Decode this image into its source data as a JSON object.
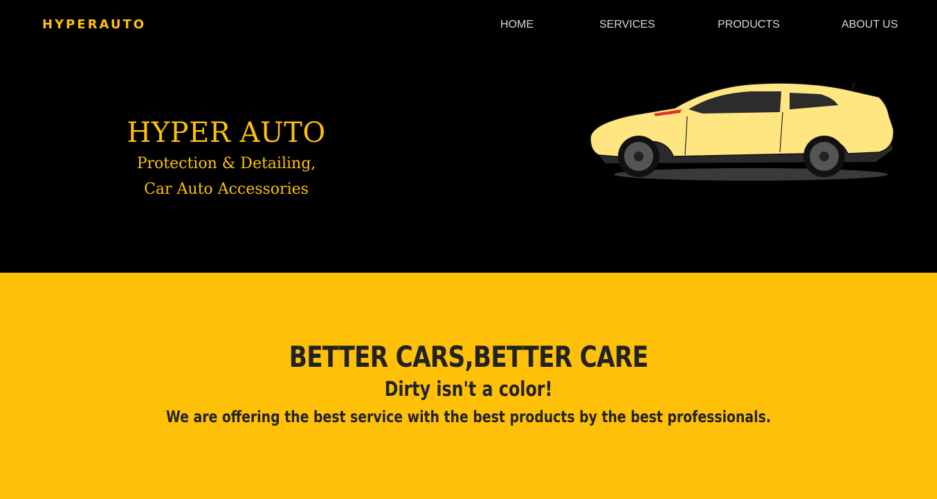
{
  "brand": {
    "logo_text": "HYPERAUTO",
    "color": "#ffc107"
  },
  "nav": {
    "items": [
      {
        "label": "HOME"
      },
      {
        "label": "SERVICES"
      },
      {
        "label": "PRODUCTS"
      },
      {
        "label": "ABOUT US"
      }
    ]
  },
  "hero": {
    "title": "HYPER AUTO",
    "subtitle_line1": "Protection & Detailing,",
    "subtitle_line2": "Car Auto Accessories",
    "image": "yellow-sports-car-illustration"
  },
  "band": {
    "heading": "BETTER CARS,BETTER CARE",
    "tagline": "Dirty isn't a color!",
    "description": "We are offering the best service with the best products by the best professionals.",
    "background": "#ffc107"
  }
}
